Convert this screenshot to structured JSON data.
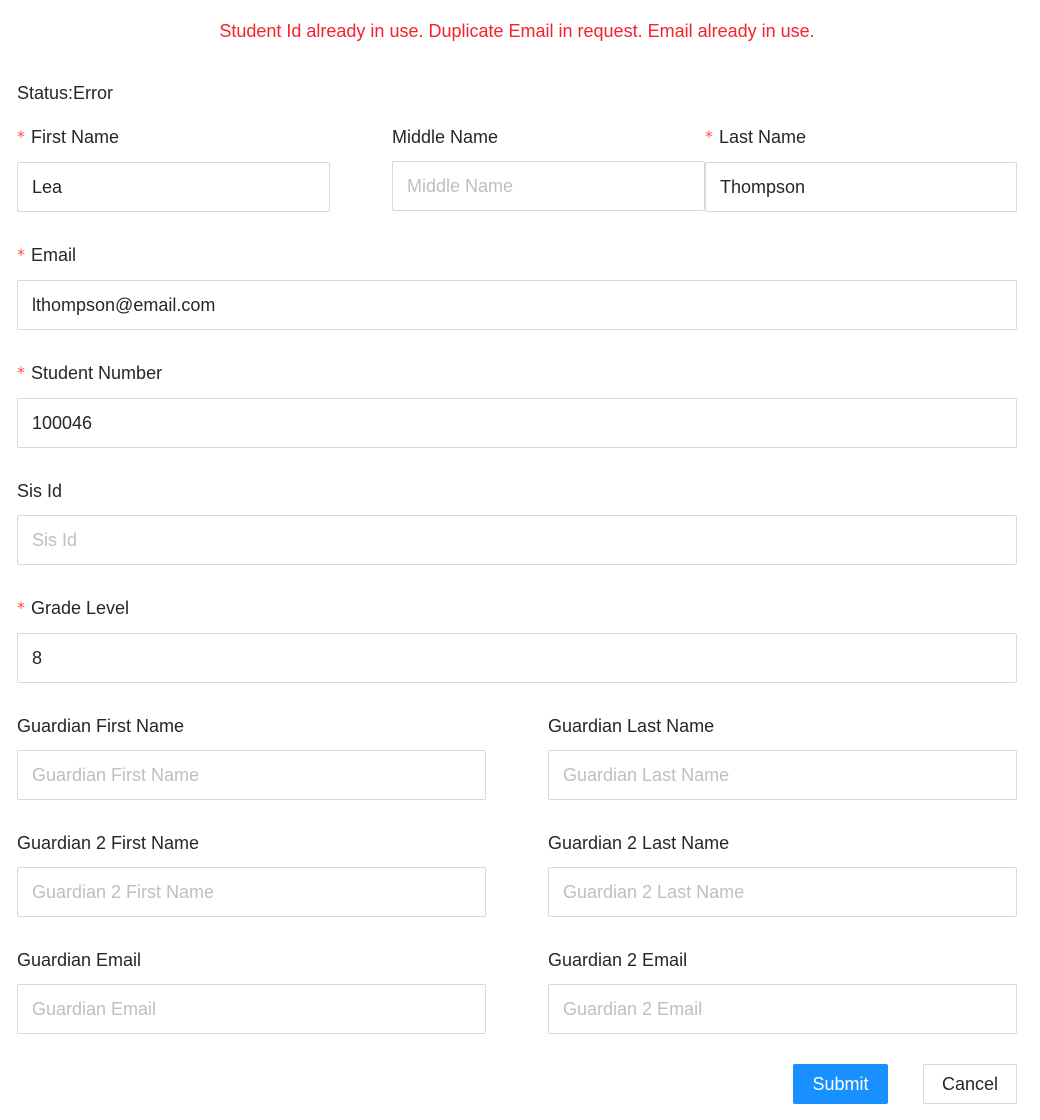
{
  "error_message": "Student Id already in use. Duplicate Email in request. Email already in use.",
  "status_text": "Status:Error",
  "colors": {
    "error": "#f5222d",
    "required_mark": "#ff4d4f",
    "primary": "#1890ff",
    "border": "#d9d9d9",
    "placeholder": "#bfbfbf"
  },
  "form": {
    "first_name": {
      "label": "First Name",
      "value": "Lea",
      "placeholder": "First Name",
      "required": true
    },
    "middle_name": {
      "label": "Middle Name",
      "value": "",
      "placeholder": "Middle Name",
      "required": false
    },
    "last_name": {
      "label": "Last Name",
      "value": "Thompson",
      "placeholder": "Last Name",
      "required": true
    },
    "email": {
      "label": "Email",
      "value": "lthompson@email.com",
      "placeholder": "Email",
      "required": true
    },
    "student_number": {
      "label": "Student Number",
      "value": "100046",
      "placeholder": "Student Number",
      "required": true
    },
    "sis_id": {
      "label": "Sis Id",
      "value": "",
      "placeholder": "Sis Id",
      "required": false
    },
    "grade_level": {
      "label": "Grade Level",
      "value": "8",
      "placeholder": "Grade Level",
      "required": true
    },
    "guardian_first_name": {
      "label": "Guardian First Name",
      "value": "",
      "placeholder": "Guardian First Name"
    },
    "guardian_last_name": {
      "label": "Guardian Last Name",
      "value": "",
      "placeholder": "Guardian Last Name"
    },
    "guardian2_first_name": {
      "label": "Guardian 2 First Name",
      "value": "",
      "placeholder": "Guardian 2 First Name"
    },
    "guardian2_last_name": {
      "label": "Guardian 2 Last Name",
      "value": "",
      "placeholder": "Guardian 2 Last Name"
    },
    "guardian_email": {
      "label": "Guardian Email",
      "value": "",
      "placeholder": "Guardian Email"
    },
    "guardian2_email": {
      "label": "Guardian 2 Email",
      "value": "",
      "placeholder": "Guardian 2 Email"
    }
  },
  "buttons": {
    "submit": "Submit",
    "cancel": "Cancel"
  },
  "required_mark": "*"
}
